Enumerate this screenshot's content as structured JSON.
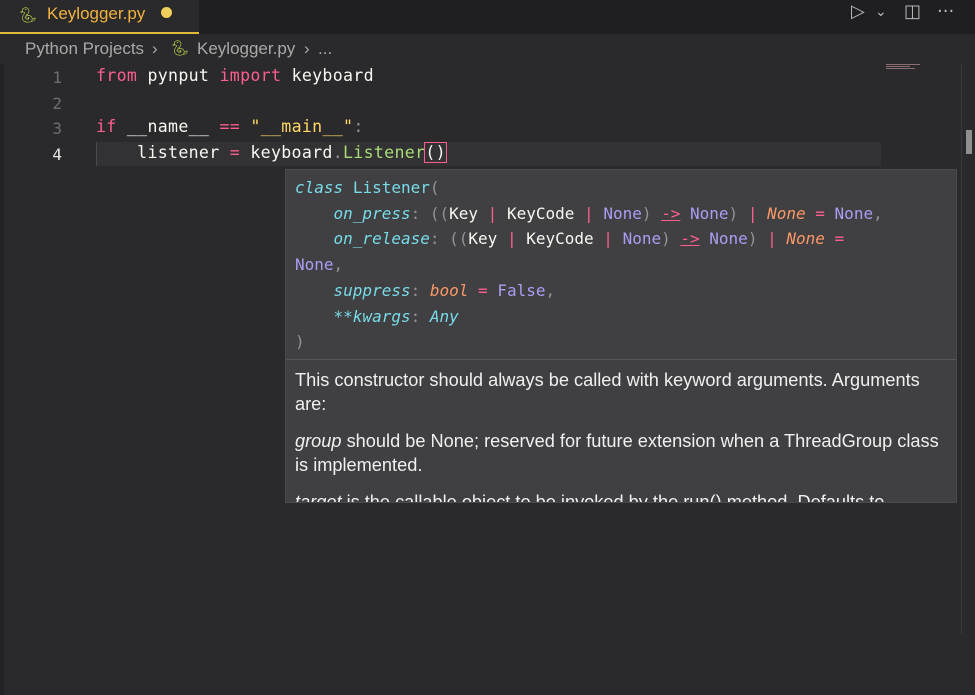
{
  "tab": {
    "filename": "Keylogger.py",
    "icon": "python-icon"
  },
  "toolbar": {
    "run_icon": "▷",
    "chevron_icon": "⌄",
    "split_icon": "◫",
    "more_icon": "···"
  },
  "breadcrumb": {
    "folder": "Python Projects",
    "sep1": "›",
    "file": "Keylogger.py",
    "sep2": "›",
    "tail": "..."
  },
  "editor": {
    "lines": [
      {
        "num": "1"
      },
      {
        "num": "2"
      },
      {
        "num": "3"
      },
      {
        "num": "4"
      }
    ],
    "line1": {
      "kw1": "from",
      "mod": "pynput",
      "kw2": "import",
      "name": "keyboard"
    },
    "line3": {
      "kw": "if",
      "name": "__name__",
      "op": "==",
      "str": "\"__main__\"",
      "colon": ":"
    },
    "line4": {
      "var": "listener",
      "eq": "=",
      "obj": "keyboard",
      "dot": ".",
      "cls": "Listener",
      "paren": "()"
    }
  },
  "hover": {
    "sig": {
      "class_kw": "class",
      "class_name": "Listener",
      "open": "(",
      "p1": "on_press",
      "p2": "on_release",
      "p3": "suppress",
      "p4": "**kwargs",
      "key": "Key",
      "keycode": "KeyCode",
      "none": "None",
      "arrow": "->",
      "bool": "bool",
      "false": "False",
      "any": "Any",
      "close": ")"
    },
    "doc": {
      "p1": "This constructor should always be called with keyword arguments. Arguments are:",
      "p2_em": "group",
      "p2": " should be None; reserved for future extension when a ThreadGroup class is implemented.",
      "p3_em": "target",
      "p3": " is the callable object to be invoked by the run() method. Defaults to"
    }
  }
}
